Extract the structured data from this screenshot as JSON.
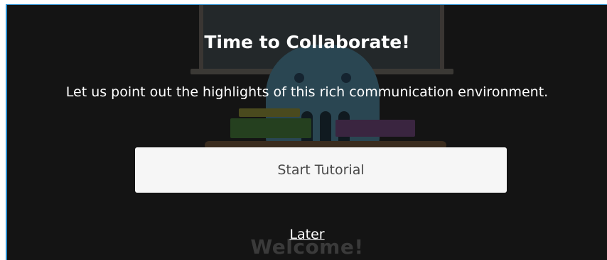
{
  "modal": {
    "title": "Time to Collaborate!",
    "subtitle": "Let us point out the highlights of this rich communication environment.",
    "start_button_label": "Start Tutorial",
    "later_link_label": "Later"
  },
  "background": {
    "welcome_text": "Welcome!"
  },
  "colors": {
    "frame_border": "#2a8fd1",
    "overlay": "#141414",
    "button_bg": "#f6f6f6",
    "text": "#ffffff"
  }
}
